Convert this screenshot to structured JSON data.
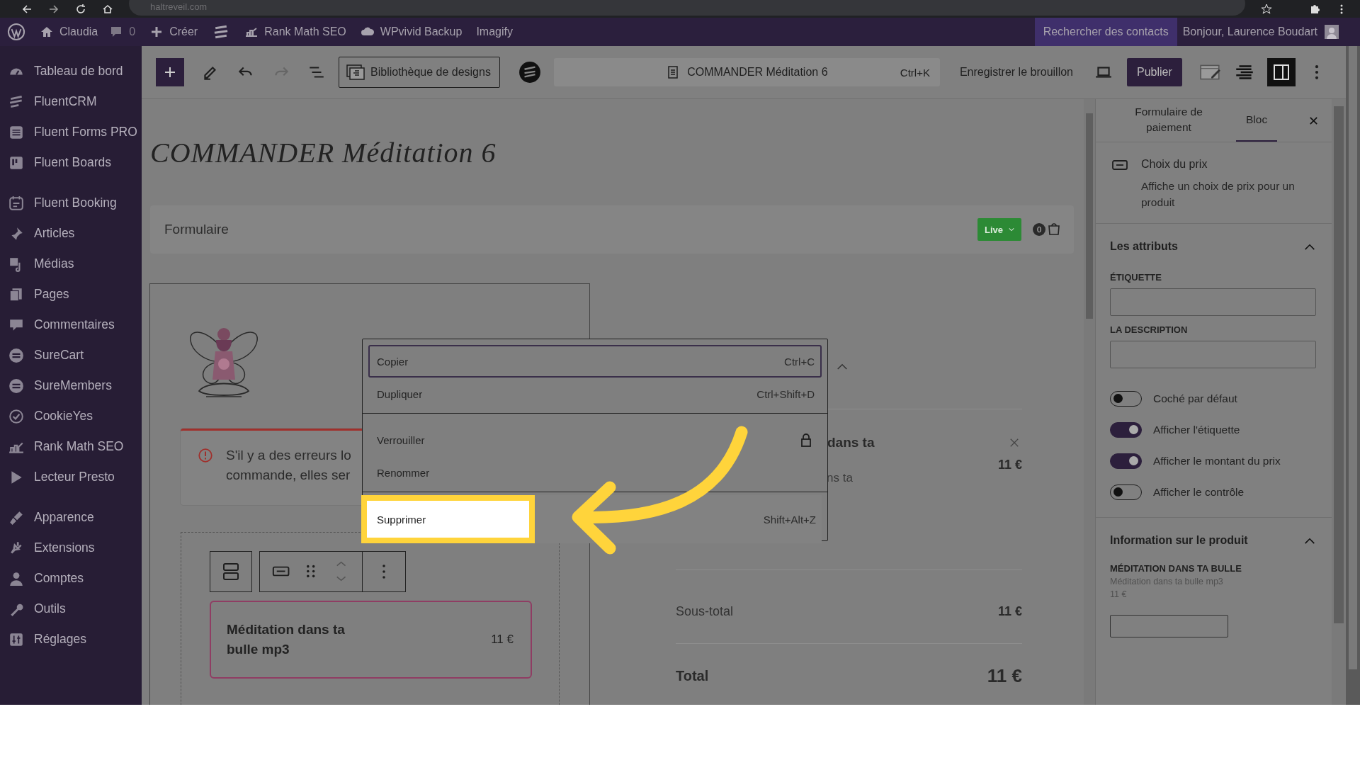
{
  "browser": {
    "address": "haltreveil.com"
  },
  "admin_bar": {
    "site": "Claudia",
    "comments": "0",
    "new": "Créer",
    "items": [
      "Rank Math SEO",
      "WPvivid Backup",
      "Imagify"
    ],
    "search_contacts": "Rechercher des contacts",
    "greeting": "Bonjour, Laurence Boudart"
  },
  "sidebar": {
    "groups": [
      {
        "items": [
          "Tableau de bord",
          "FluentCRM",
          "Fluent Forms PRO",
          "Fluent Boards"
        ]
      },
      {
        "items": [
          "Fluent Booking",
          "Articles",
          "Médias",
          "Pages",
          "Commentaires",
          "SureCart",
          "SureMembers",
          "CookieYes",
          "Rank Math SEO",
          "Lecteur Presto"
        ]
      },
      {
        "items": [
          "Apparence",
          "Extensions",
          "Comptes",
          "Outils",
          "Réglages"
        ]
      }
    ]
  },
  "toolbar": {
    "undo_disabled": false,
    "redo_disabled": true,
    "design_library": "Bibliothèque de designs",
    "document": "COMMANDER Méditation 6",
    "shortcut": "Ctrl+K",
    "save_draft": "Enregistrer le brouillon",
    "publish": "Publier",
    "sidebar_open": true
  },
  "page": {
    "title": "COMMANDER Méditation 6",
    "form_label": "Formulaire",
    "status": "Live",
    "cart_count": "0",
    "notice_lines": [
      "S'il y a des erreurs lo",
      "commande, elles ser"
    ],
    "product": {
      "name": "Méditation dans ta bulle mp3",
      "price": "11 €"
    },
    "summary": {
      "item_name": "dans ta",
      "item_price": "11 €",
      "item_sub": "ns ta",
      "subtotal_label": "Sous-total",
      "subtotal": "11 €",
      "total_label": "Total",
      "total": "11 €"
    }
  },
  "context_menu": {
    "groups": [
      {
        "items": [
          {
            "label": "Copier",
            "kind": "shortcut",
            "shortcut": "Ctrl+C",
            "focused": true,
            "highlighted": false
          },
          {
            "label": "Dupliquer",
            "kind": "shortcut",
            "shortcut": "Ctrl+Shift+D",
            "focused": false,
            "highlighted": false
          }
        ]
      },
      {
        "items": [
          {
            "label": "Verrouiller",
            "kind": "lock",
            "focused": false,
            "highlighted": false
          },
          {
            "label": "Renommer",
            "kind": "plain",
            "focused": false,
            "highlighted": false
          }
        ]
      },
      {
        "items": [
          {
            "label": "Supprimer",
            "kind": "shortcut",
            "shortcut": "Shift+Alt+Z",
            "focused": false,
            "highlighted": true
          }
        ]
      }
    ]
  },
  "panel": {
    "tabs": [
      {
        "label": "Formulaire de paiement",
        "selected": false
      },
      {
        "label": "Bloc",
        "selected": true
      }
    ],
    "block": {
      "name": "Choix du prix",
      "description": "Affiche un choix de prix pour un produit"
    },
    "attributes": {
      "title": "Les attributs",
      "expanded": true,
      "fields": [
        {
          "label": "ÉTIQUETTE"
        },
        {
          "label": "LA DESCRIPTION"
        }
      ],
      "toggles": [
        {
          "label": "Coché par défaut",
          "on": false
        },
        {
          "label": "Afficher l'étiquette",
          "on": true
        },
        {
          "label": "Afficher le montant du prix",
          "on": true
        },
        {
          "label": "Afficher le contrôle",
          "on": false
        }
      ]
    },
    "product_info": {
      "title": "Information sur le produit",
      "expanded": true,
      "name": "MÉDITATION DANS TA BULLE",
      "variant": "Méditation dans ta bulle mp3",
      "price": "11 €"
    }
  }
}
